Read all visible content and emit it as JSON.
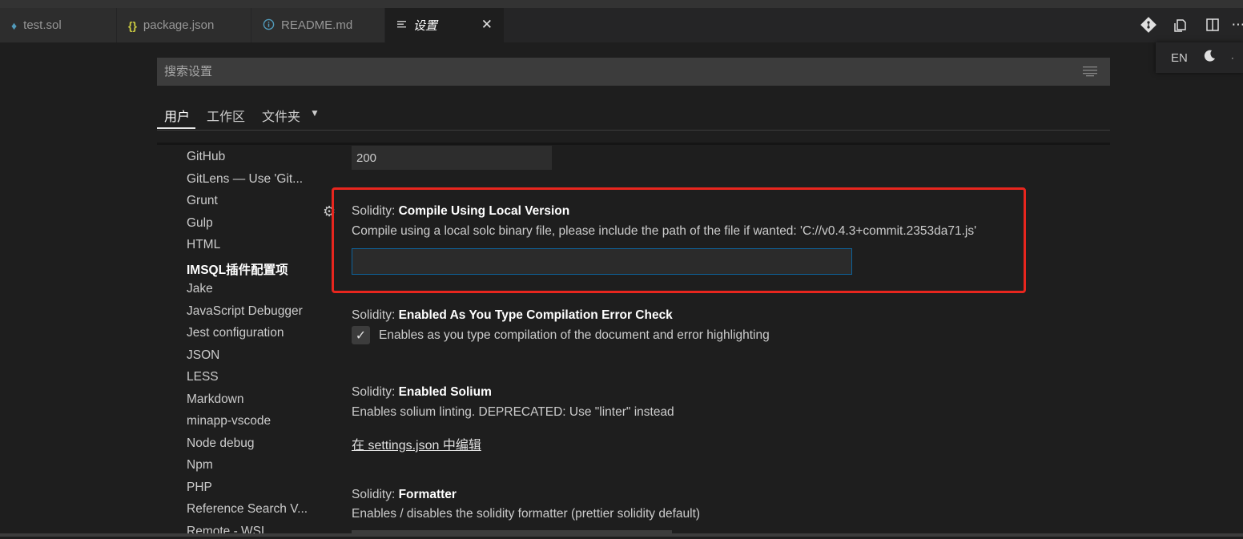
{
  "tabs": [
    {
      "label": "test.sol",
      "icon": "solidity-icon",
      "icon_color": "#519aba"
    },
    {
      "label": "package.json",
      "icon": "json-braces-icon",
      "icon_color": "#cbcb41"
    },
    {
      "label": "README.md",
      "icon": "info-icon",
      "icon_color": "#519aba"
    },
    {
      "label": "设置",
      "icon": "settings-doc-icon",
      "active": true
    }
  ],
  "tab_close": "✕",
  "language_popup": {
    "lang": "EN"
  },
  "search": {
    "placeholder": "搜索设置"
  },
  "scopes": [
    {
      "label": "用户",
      "active": true
    },
    {
      "label": "工作区"
    },
    {
      "label": "文件夹"
    }
  ],
  "toc": [
    "GitHub",
    "GitLens — Use 'Git...",
    "Grunt",
    "Gulp",
    "HTML",
    "IMSQL插件配置项",
    "Jake",
    "JavaScript Debugger",
    "Jest configuration",
    "JSON",
    "LESS",
    "Markdown",
    "minapp-vscode",
    "Node debug",
    "Npm",
    "PHP",
    "Reference Search V...",
    "Remote - WSL"
  ],
  "toc_bold_item": "IMSQL插件配置项",
  "previous_value": "200",
  "settings": [
    {
      "category": "Solidity: ",
      "name": "Compile Using Local Version",
      "description": "Compile using a local solc binary file, please include the path of the file if wanted: 'C://v0.4.3+commit.2353da71.js'",
      "value": ""
    },
    {
      "category": "Solidity: ",
      "name": "Enabled As You Type Compilation Error Check",
      "description": "Enables as you type compilation of the document and error highlighting",
      "checked": true
    },
    {
      "category": "Solidity: ",
      "name": "Enabled Solium",
      "description": "Enables solium linting. DEPRECATED: Use \"linter\" instead",
      "link": "在 settings.json 中编辑"
    },
    {
      "category": "Solidity: ",
      "name": "Formatter",
      "description": "Enables / disables the solidity formatter (prettier solidity default)"
    }
  ],
  "colors": {
    "highlight_box": "#e8261e",
    "focus_border": "#0e639c"
  }
}
